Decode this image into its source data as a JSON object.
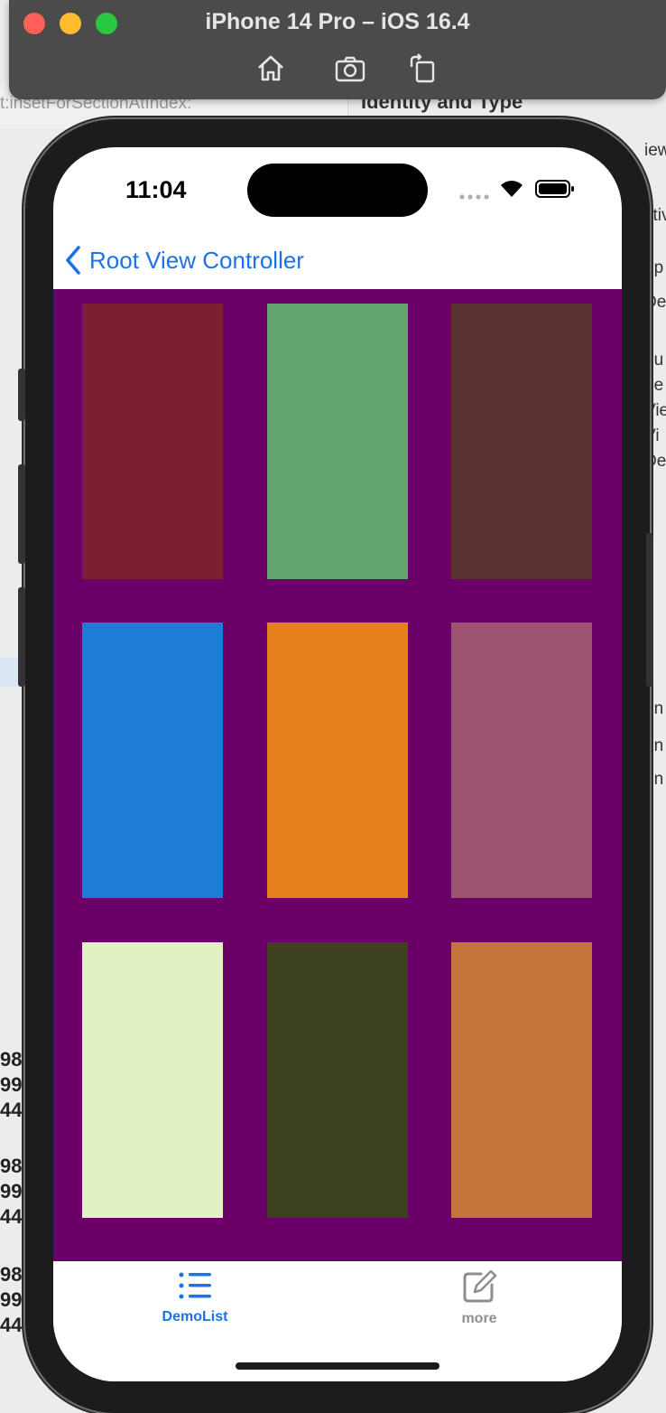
{
  "simulator": {
    "title": "iPhone 14 Pro – iOS 16.4",
    "toolbar_icons": [
      "home-icon",
      "screenshot-icon",
      "rotate-icon"
    ]
  },
  "background": {
    "method_text": "t:insetForSectionAtIndex:",
    "section_title": "Identity and Type",
    "right_fragments": [
      "iewDe",
      "ctiv",
      "up",
      "De",
      "hu",
      "de",
      "Vie",
      "Vi",
      "De",
      "en",
      "en",
      "en"
    ],
    "left_numbers": [
      "98",
      "99",
      "44",
      "98",
      "99",
      "44",
      "98",
      "99",
      "44"
    ]
  },
  "status_bar": {
    "time": "11:04",
    "icons": [
      "signal-dots-icon",
      "wifi-icon",
      "battery-icon"
    ]
  },
  "nav": {
    "back_label": "Root View Controller",
    "back_icon": "chevron-left-icon"
  },
  "collection": {
    "background": "#6b0068",
    "cells": [
      {
        "color": "#7d1f33"
      },
      {
        "color": "#62a46f"
      },
      {
        "color": "#5a3233"
      },
      {
        "color": "#1f7cd6"
      },
      {
        "color": "#e5801a"
      },
      {
        "color": "#9c5370"
      },
      {
        "color": "#e0f2c4"
      },
      {
        "color": "#3f4220"
      },
      {
        "color": "#c6743b"
      }
    ]
  },
  "tabbar": {
    "tabs": [
      {
        "label": "DemoList",
        "icon": "list-icon",
        "selected": true,
        "color": "#1a73e8"
      },
      {
        "label": "more",
        "icon": "compose-icon",
        "selected": false,
        "color": "#8e8e93"
      }
    ]
  }
}
